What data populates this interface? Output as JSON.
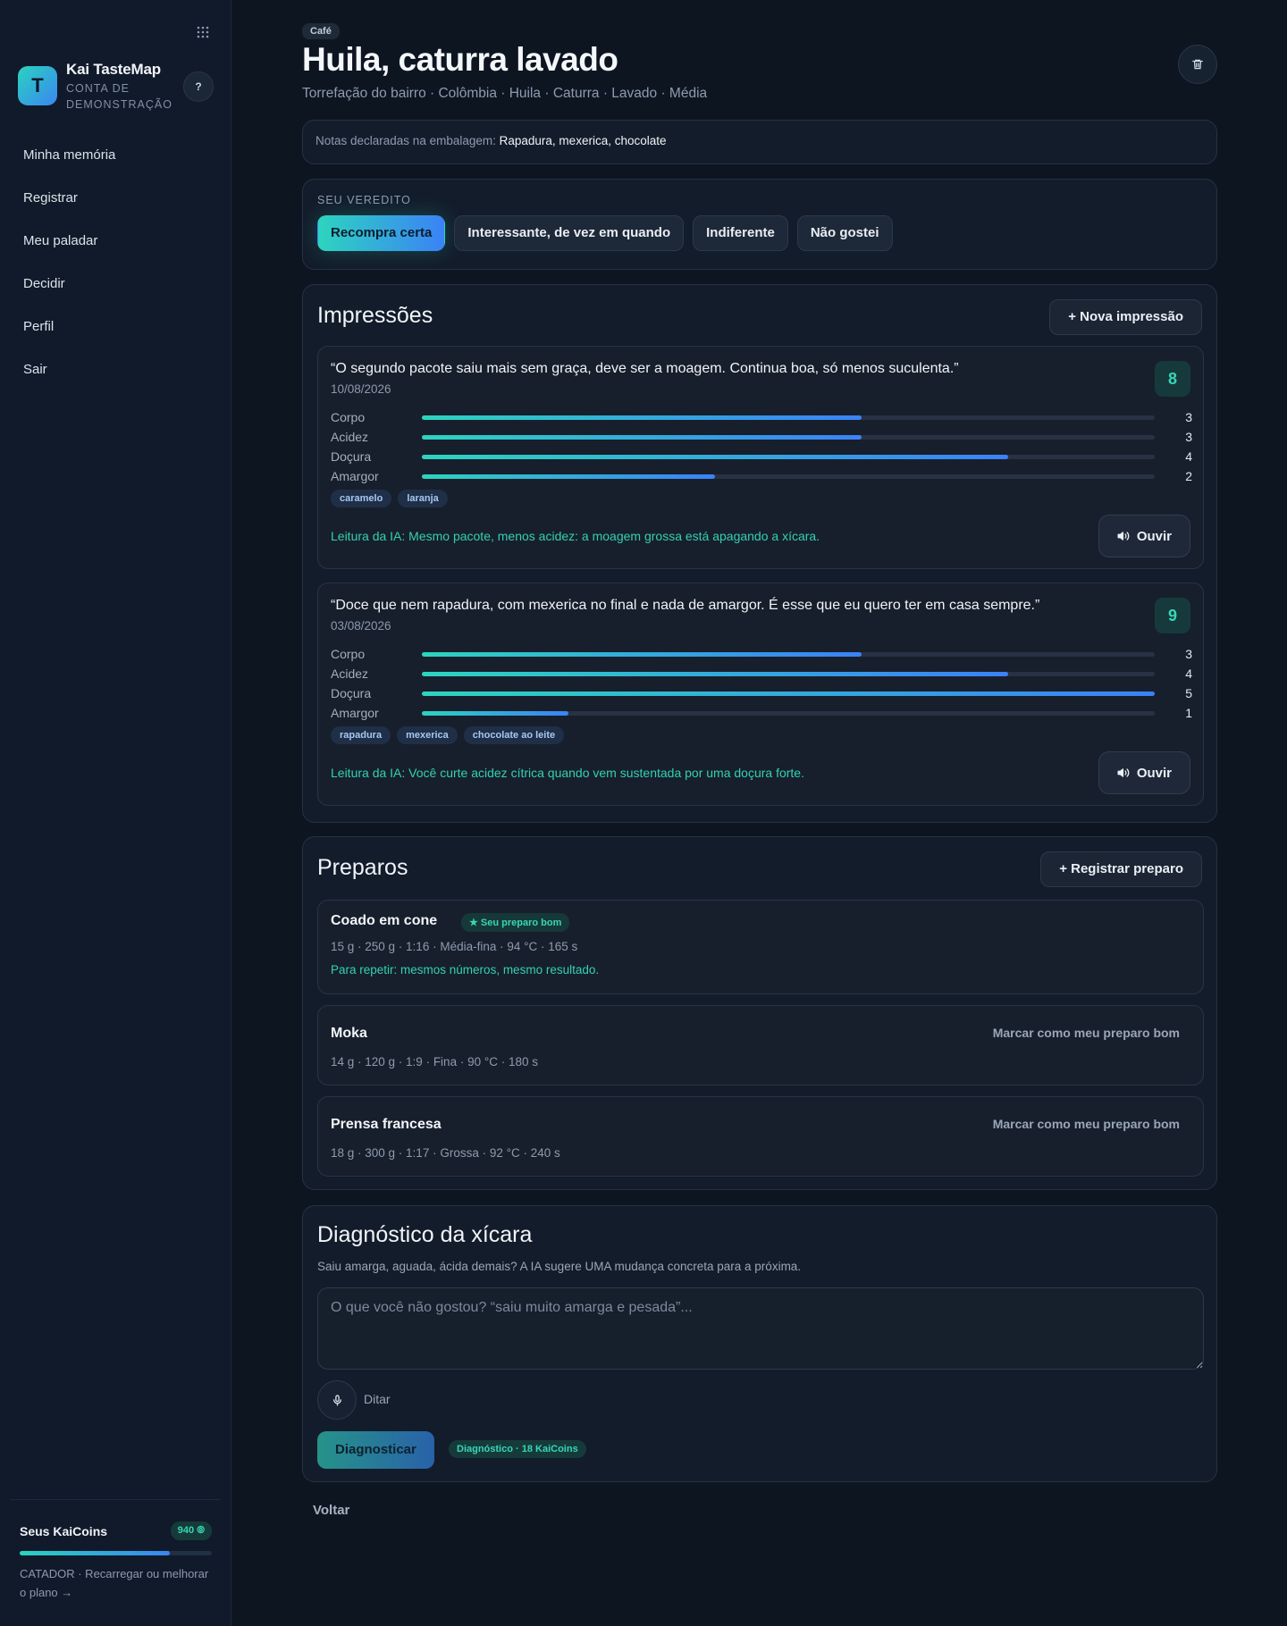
{
  "sidebar": {
    "brand_name": "Kai TasteMap",
    "brand_sub": "CONTA DE DEMONSTRAÇÃO",
    "logo_letter": "T",
    "help_label": "?",
    "nav": [
      {
        "label": "Minha memória"
      },
      {
        "label": "Registrar"
      },
      {
        "label": "Meu paladar"
      },
      {
        "label": "Decidir"
      },
      {
        "label": "Perfil"
      },
      {
        "label": "Sair"
      }
    ],
    "coins": {
      "title": "Seus KaiCoins",
      "balance": "940 ⦾",
      "progress": 0.78,
      "link": "CATADOR · Recarregar ou melhorar o plano →"
    }
  },
  "header": {
    "category": "Café",
    "title": "Huila, caturra lavado",
    "subtitle": "Torrefação do bairro · Colômbia · Huila · Caturra · Lavado · Média"
  },
  "notes": {
    "label": "Notas declaradas na embalagem:",
    "value": "Rapadura, mexerica, chocolate"
  },
  "verdict": {
    "label": "SEU VEREDITO",
    "options": [
      {
        "label": "Recompra certa",
        "active": true
      },
      {
        "label": "Interessante, de vez em quando",
        "active": false
      },
      {
        "label": "Indiferente",
        "active": false
      },
      {
        "label": "Não gostei",
        "active": false
      }
    ]
  },
  "impressions": {
    "title": "Impressões",
    "add_label": "+ Nova impressão",
    "max_scale": 5,
    "items": [
      {
        "quote": "“O segundo pacote saiu mais sem graça, deve ser a moagem. Continua boa, só menos suculenta.”",
        "date": "10/08/2026",
        "score": "8",
        "attributes": [
          {
            "name": "Corpo",
            "value": 3
          },
          {
            "name": "Acidez",
            "value": 3
          },
          {
            "name": "Doçura",
            "value": 4
          },
          {
            "name": "Amargor",
            "value": 2
          }
        ],
        "tags": [
          "caramelo",
          "laranja"
        ],
        "ai_reading": "Leitura da IA: Mesmo pacote, menos acidez: a moagem grossa está apagando a xícara.",
        "listen_label": "Ouvir"
      },
      {
        "quote": "“Doce que nem rapadura, com mexerica no final e nada de amargor. É esse que eu quero ter em casa sempre.”",
        "date": "03/08/2026",
        "score": "9",
        "attributes": [
          {
            "name": "Corpo",
            "value": 3
          },
          {
            "name": "Acidez",
            "value": 4
          },
          {
            "name": "Doçura",
            "value": 5
          },
          {
            "name": "Amargor",
            "value": 1
          }
        ],
        "tags": [
          "rapadura",
          "mexerica",
          "chocolate ao leite"
        ],
        "ai_reading": "Leitura da IA: Você curte acidez cítrica quando vem sustentada por uma doçura forte.",
        "listen_label": "Ouvir"
      }
    ]
  },
  "preparos": {
    "title": "Preparos",
    "add_label": "+ Registrar preparo",
    "items": [
      {
        "name": "Coado em cone",
        "badge": "★ Seu preparo bom",
        "meta": "15 g · 250 g · 1:16 · Média-fina · 94 °C · 165 s",
        "tip": "Para repetir: mesmos números, mesmo resultado."
      },
      {
        "name": "Moka",
        "meta": "14 g · 120 g · 1:9 · Fina · 90 °C · 180 s",
        "mark_label": "Marcar como meu preparo bom"
      },
      {
        "name": "Prensa francesa",
        "meta": "18 g · 300 g · 1:17 · Grossa · 92 °C · 240 s",
        "mark_label": "Marcar como meu preparo bom"
      }
    ]
  },
  "diagnostico": {
    "title": "Diagnóstico da xícara",
    "subtitle": "Saiu amarga, aguada, ácida demais? A IA sugere UMA mudança concreta para a próxima.",
    "placeholder": "O que você não gostou? “saiu muito amarga e pesada”...",
    "dictate_label": "Ditar",
    "button_label": "Diagnosticar",
    "cost_label": "Diagnóstico · 18 KaiCoins"
  },
  "back_label": "Voltar",
  "colors": {
    "accent_teal": "#2dd4bf",
    "accent_blue": "#3b82f6",
    "background": "#0d1521"
  }
}
